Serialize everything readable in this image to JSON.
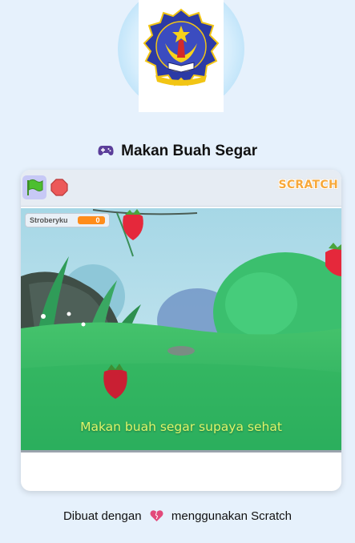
{
  "header": {
    "title": "Makan Buah Segar",
    "title_icon": "gamepad-icon"
  },
  "toolbar": {
    "green_flag_icon": "green-flag-icon",
    "stop_icon": "stop-sign-icon",
    "brand_logo": "SCRATCH"
  },
  "stage": {
    "variable_monitor": {
      "label": "Stroberyku",
      "value": "0"
    },
    "caption": "Makan buah segar supaya sehat"
  },
  "footer": {
    "prefix": "Dibuat dengan",
    "heart_icon": "heart-icon",
    "suffix": "menggunakan Scratch"
  },
  "colors": {
    "page_background": "#e6f1fc",
    "monitor_value": "#ff8c1a",
    "caption_text": "#dff56a",
    "scratch_orange": "#f7a83a"
  }
}
